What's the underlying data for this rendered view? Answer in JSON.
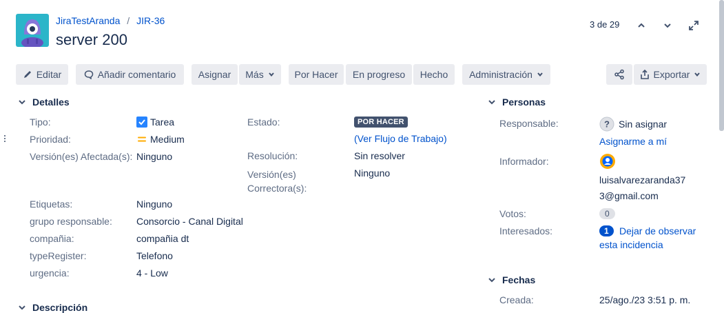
{
  "header": {
    "project": "JiraTestAranda",
    "separator": "/",
    "issue_key": "JIR-36",
    "title": "server 200",
    "pager": "3 de 29"
  },
  "toolbar": {
    "edit": "Editar",
    "comment": "Añadir comentario",
    "assign": "Asignar",
    "more": "Más",
    "todo": "Por Hacer",
    "in_progress": "En progreso",
    "done": "Hecho",
    "admin": "Administración",
    "export": "Exportar"
  },
  "details": {
    "heading": "Detalles",
    "type_label": "Tipo:",
    "type_value": "Tarea",
    "priority_label": "Prioridad:",
    "priority_value": "Medium",
    "affected_label": "Versión(es) Afectada(s):",
    "affected_value": "Ninguno",
    "status_label": "Estado:",
    "status_value": "POR HACER",
    "workflow_link": "(Ver Flujo de Trabajo)",
    "resolution_label": "Resolución:",
    "resolution_value": "Sin resolver",
    "fix_label_1": "Versión(es)",
    "fix_label_2": "Correctora(s):",
    "fix_value": "Ninguno",
    "labels_label": "Etiquetas:",
    "labels_value": "Ninguno",
    "group_label": "grupo responsable:",
    "group_value": "Consorcio - Canal Digital",
    "company_label": "compañia:",
    "company_value": "compañia dt",
    "typeregister_label": "typeRegister:",
    "typeregister_value": "Telefono",
    "urgency_label": "urgencia:",
    "urgency_value": "4 - Low"
  },
  "description": {
    "heading": "Descripción"
  },
  "people": {
    "heading": "Personas",
    "assignee_label": "Responsable:",
    "assignee_value": "Sin asignar",
    "assign_me": "Asignarme a mí",
    "reporter_label": "Informador:",
    "reporter_line1": "luisalvarezaranda37",
    "reporter_line2": "3@gmail.com",
    "votes_label": "Votos:",
    "votes_value": "0",
    "watchers_label": "Interesados:",
    "watchers_count": "1",
    "watch_line1": "Dejar de observar",
    "watch_line2": "esta incidencia"
  },
  "dates": {
    "heading": "Fechas",
    "created_label": "Creada:",
    "created_value": "25/ago./23 3:51 p. m."
  },
  "colors": {
    "link": "#0052cc",
    "lozenge": "#42526e",
    "button_bg": "#ebecf0",
    "avatar": "#2bb5c9",
    "checkbox": "#2684ff",
    "priority": "#ffab00"
  },
  "icons": [
    "project-avatar",
    "chevron-up-icon",
    "chevron-down-icon",
    "expand-icon",
    "pencil-icon",
    "comment-icon",
    "share-icon",
    "export-icon",
    "checkbox-icon",
    "priority-medium-icon",
    "unknown-user-icon",
    "user-avatar-icon"
  ]
}
